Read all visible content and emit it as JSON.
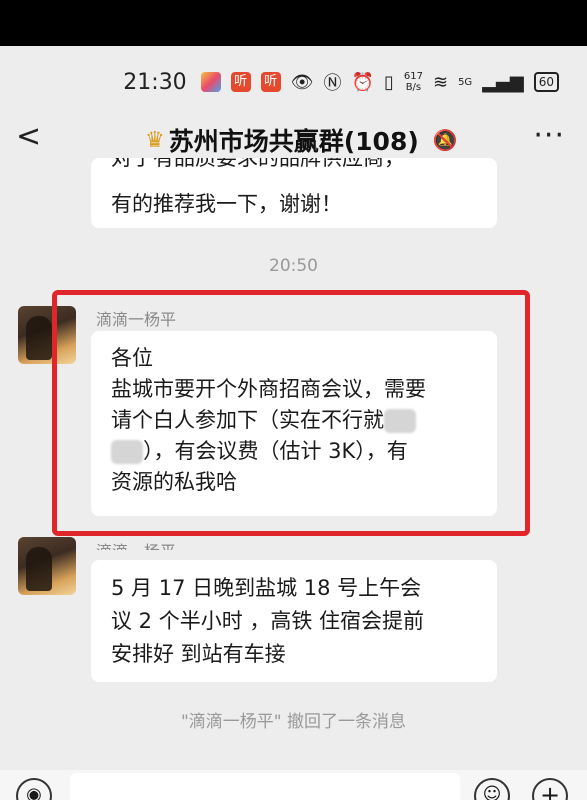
{
  "status_bar": {
    "time": "21:30",
    "app_badge_1": "听",
    "app_badge_2": "听",
    "net_speed_value": "617",
    "net_speed_unit": "B/s",
    "network_type": "5G",
    "battery": "60"
  },
  "header": {
    "back_glyph": "<",
    "title": "苏州市场共赢群(108)",
    "more_glyph": "···"
  },
  "messages": {
    "top_cut_text": "对于有品质要求的品牌供应商，",
    "top_text": "有的推荐我一下，谢谢！",
    "timestamp": "20:50",
    "msg1": {
      "sender": "滴滴一杨平",
      "line1": "各位",
      "line2": "盐城市要开个外商招商会议，需要",
      "line3": "请个白人参加下（实在不行就",
      "line4": "），有会议费（估计 3K），有",
      "line5": "资源的私我哈"
    },
    "msg2": {
      "sender": "滴滴一杨平",
      "line1": "5 月 17 日晚到盐城 18 号上午会",
      "line2": "议 2 个半小时 ，高铁 住宿会提前",
      "line3": "安排好 到站有车接"
    },
    "recall_notice": "\"滴滴一杨平\" 撤回了一条消息"
  },
  "colors": {
    "highlight_border": "#e1262b",
    "background": "#ededed",
    "bubble": "#ffffff"
  }
}
